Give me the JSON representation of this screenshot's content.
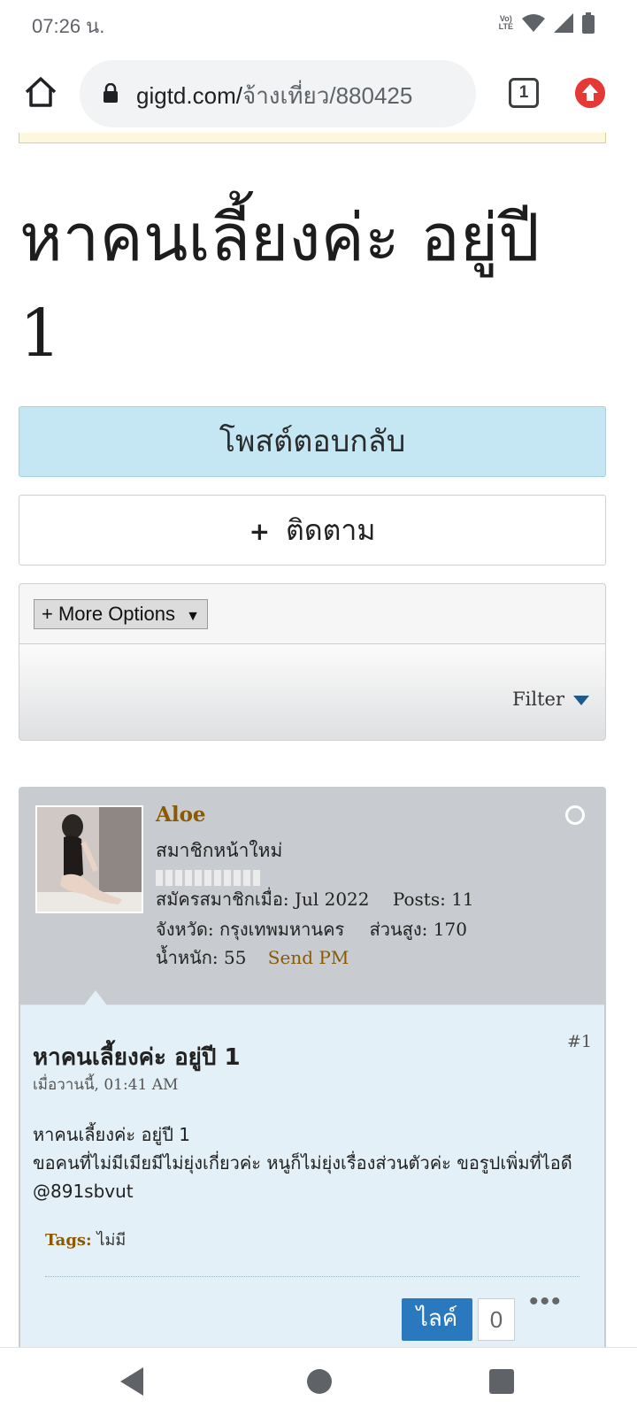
{
  "status_bar": {
    "time": "07:26 น.",
    "volte_icon": "volte-lte-icon",
    "wifi_icon": "wifi-icon",
    "signal_icon": "signal-icon",
    "battery_icon": "battery-icon"
  },
  "browser": {
    "url_domain": "gigtd.com/",
    "url_path": "จ้างเที่ยว/880425",
    "tab_count": "1"
  },
  "page": {
    "title": "หาคนเลี้ยงค่ะ อยู่ปี 1",
    "reply_label": "โพสต์ตอบกลับ",
    "follow_plus": "+",
    "follow_label": "ติดตาม",
    "more_options_label": "+ More Options",
    "more_options_arrow": "▼",
    "filter_label": "Filter"
  },
  "post": {
    "username": "Aloe",
    "user_title": "สมาชิกหน้าใหม่",
    "joined": "สมัครสมาชิกเมื่อ: Jul 2022",
    "posts": "Posts: 11",
    "province": "จังหวัด: กรุงเทพมหานคร",
    "height": "ส่วนสูง: 170",
    "weight": "น้ำหนัก: 55",
    "send_pm": "Send PM",
    "post_number": "#1",
    "post_title": "หาคนเลี้ยงค่ะ อยู่ปี 1",
    "post_date": "เมื่อวานนี้, 01:41 AM",
    "post_text": "หาคนเลี้ยงค่ะ อยู่ปี 1\n ขอคนที่ไม่มีเมียมีไม่ยุ่งเกี่ยวค่ะ หนูก็ไม่ยุ่งเรื่องส่วนตัวค่ะ ขอรูปเพิ่มที่ไอดี @891sbvut",
    "tags_label": "Tags:",
    "tags_value": "ไม่มี",
    "like_label": "ไลค์",
    "like_count": "0",
    "more_dots": "•••"
  },
  "colors": {
    "accent_blue": "#2a79bf",
    "username_brown": "#8b5a00",
    "reply_bg": "#c5e7f4"
  }
}
